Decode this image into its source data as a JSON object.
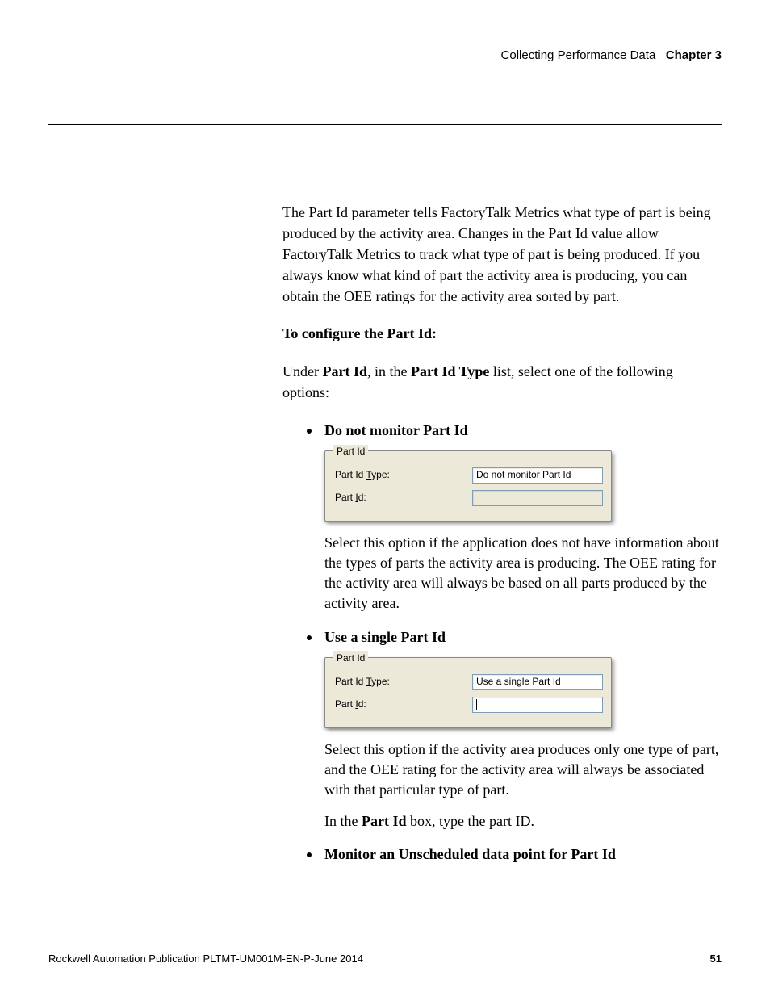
{
  "header": {
    "section": "Collecting Performance Data",
    "chapter": "Chapter 3"
  },
  "body": {
    "intro": "The Part Id parameter tells FactoryTalk Metrics what type of part is being produced by the activity area. Changes in the Part Id value allow FactoryTalk Metrics to track what type of part is being produced. If you always know what kind of part the activity area is producing, you can obtain the OEE ratings for the activity area sorted by part.",
    "configure_heading": "To configure the Part Id:",
    "configure_sentence_pre": "Under ",
    "configure_sentence_b1": "Part Id",
    "configure_sentence_mid": ", in the ",
    "configure_sentence_b2": "Part Id Type",
    "configure_sentence_post": " list, select one of the following options:",
    "option1": {
      "title": "Do not monitor Part Id",
      "desc": "Select this option if the application does not have information about the types of parts the activity area is producing. The OEE rating for the activity area will always be based on all parts produced by the activity area."
    },
    "option2": {
      "title": "Use a single Part Id",
      "desc": "Select this option if the activity area produces only one type of part, and the OEE rating for the activity area will always be associated with that particular type of part.",
      "extra_pre": "In the ",
      "extra_bold": "Part Id",
      "extra_post": " box, type the part ID."
    },
    "option3": {
      "title": "Monitor an Unscheduled data point for Part Id"
    }
  },
  "dialog": {
    "legend": "Part Id",
    "label_type_pre": "Part Id ",
    "label_type_mn": "T",
    "label_type_post": "ype:",
    "label_id_pre": "Part ",
    "label_id_mn": "I",
    "label_id_post": "d:",
    "value1": "Do not monitor Part Id",
    "value2": "Use a single Part Id"
  },
  "footer": {
    "publication": "Rockwell Automation Publication PLTMT-UM001M-EN-P-June 2014",
    "page": "51"
  }
}
